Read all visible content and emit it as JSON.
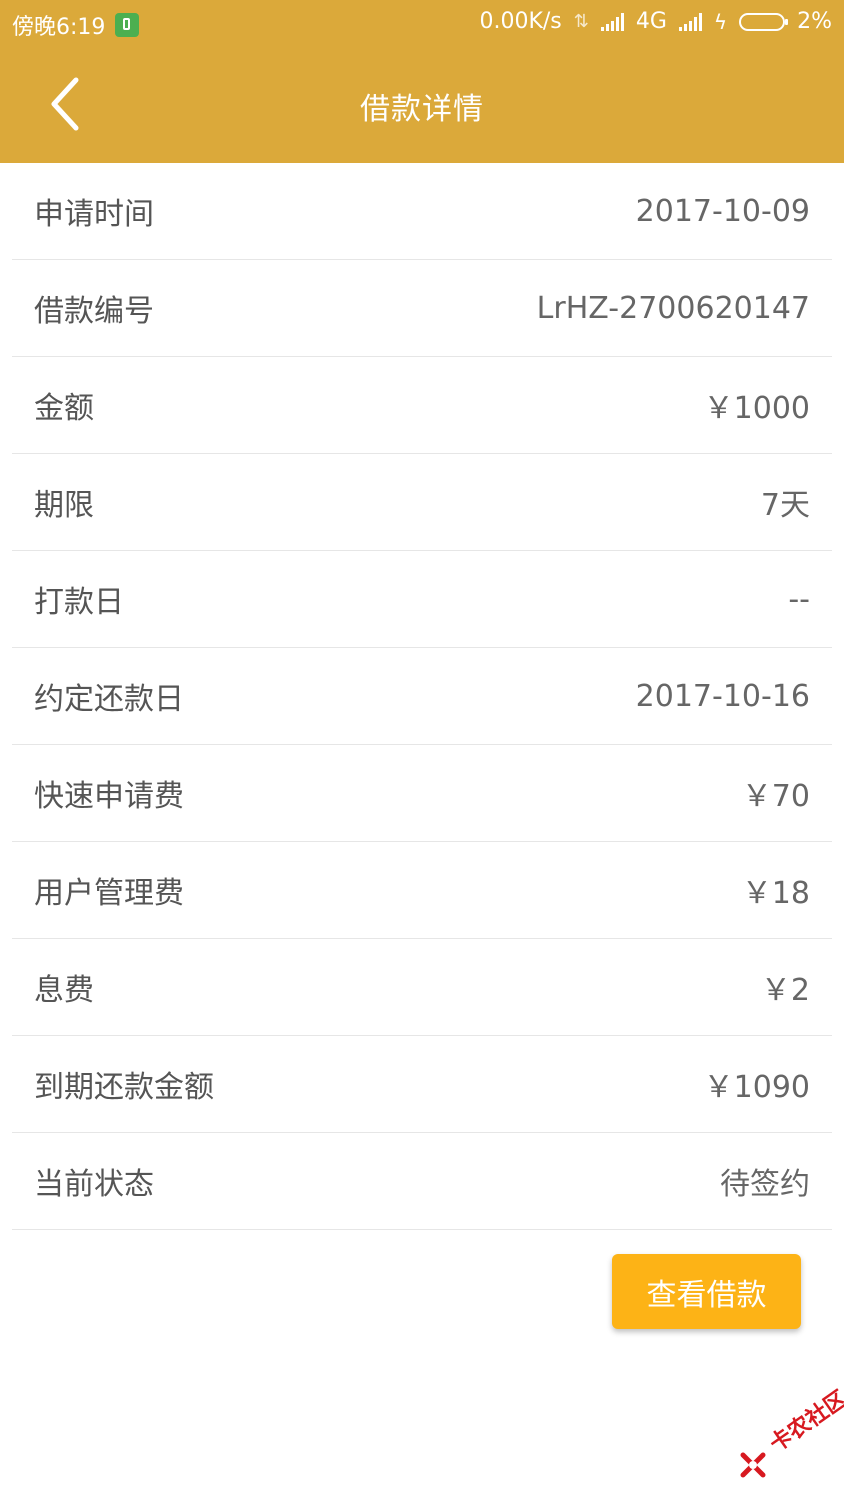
{
  "status_bar": {
    "time": "傍晚6:19",
    "network_speed": "0.00K/s",
    "network_type": "4G",
    "battery": "2%",
    "icons": [
      "app-notification-icon",
      "data-arrows-icon",
      "signal-icon",
      "signal-icon",
      "charging-icon",
      "battery-icon"
    ]
  },
  "header": {
    "title": "借款详情",
    "back_icon": "chevron-left-icon",
    "background_color": "#DBA93A"
  },
  "details": [
    {
      "label": "申请时间",
      "value": "2017-10-09"
    },
    {
      "label": "借款编号",
      "value": "LrHZ-2700620147"
    },
    {
      "label": "金额",
      "value": "￥1000"
    },
    {
      "label": "期限",
      "value": "7天"
    },
    {
      "label": "打款日",
      "value": "--"
    },
    {
      "label": "约定还款日",
      "value": "2017-10-16"
    },
    {
      "label": "快速申请费",
      "value": "￥70"
    },
    {
      "label": "用户管理费",
      "value": "￥18"
    },
    {
      "label": "息费",
      "value": "￥2"
    },
    {
      "label": "到期还款金额",
      "value": "￥1090"
    },
    {
      "label": "当前状态",
      "value": "待签约"
    }
  ],
  "action": {
    "label": "查看借款",
    "color": "#FDB316"
  },
  "watermark": {
    "text": "卡农社区"
  }
}
